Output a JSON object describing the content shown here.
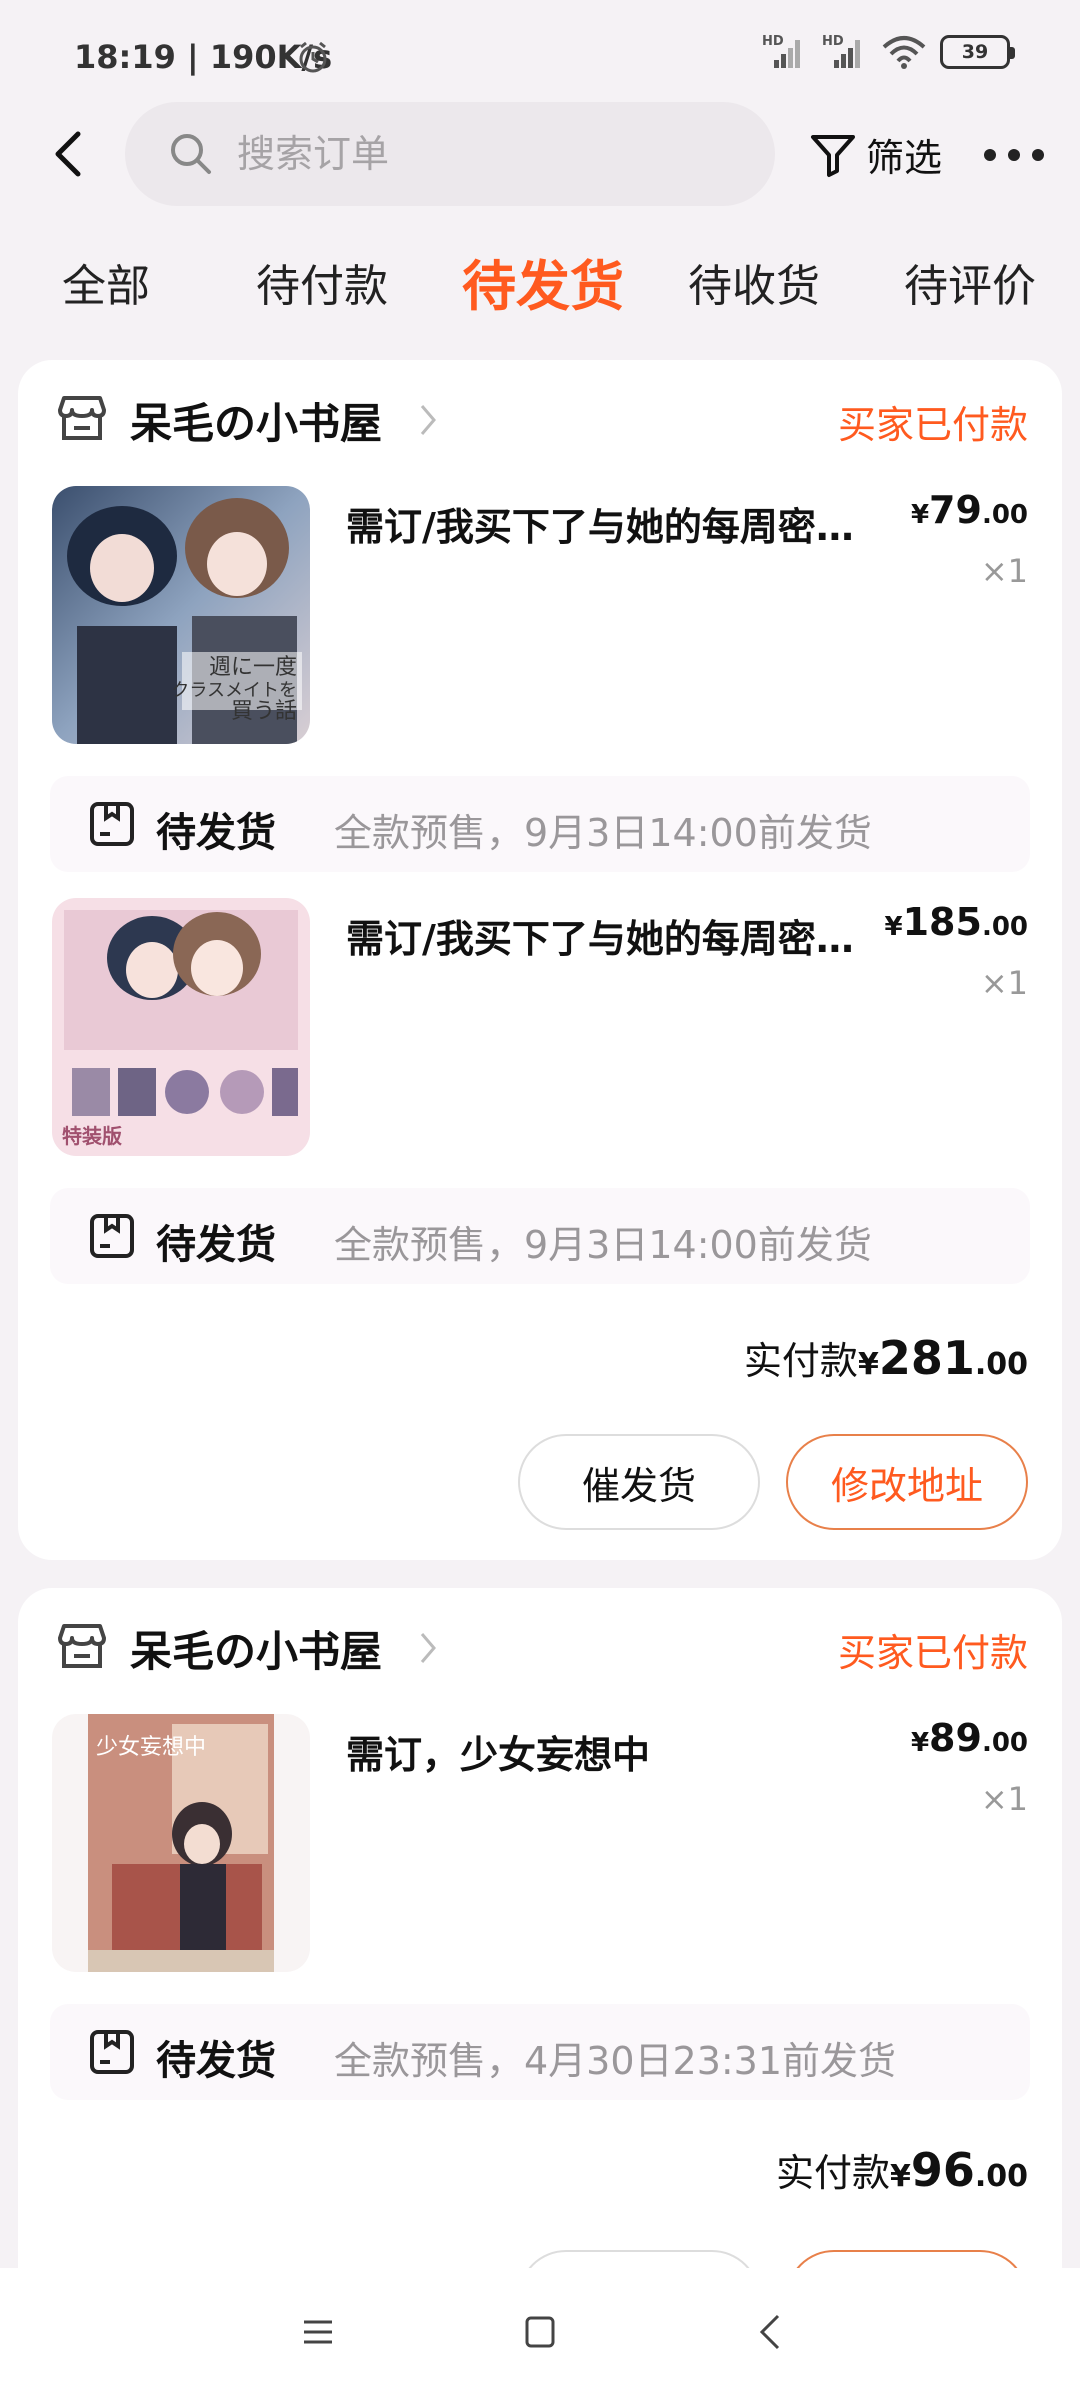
{
  "status_bar": {
    "time": "18:19 | 190K/s",
    "battery": "39",
    "signal_1_label": "HD",
    "signal_2_label": "HD"
  },
  "header": {
    "search_placeholder": "搜索订单",
    "filter_label": "筛选"
  },
  "tabs": [
    {
      "label": "全部",
      "active": false
    },
    {
      "label": "待付款",
      "active": false
    },
    {
      "label": "待发货",
      "active": true
    },
    {
      "label": "待收货",
      "active": false
    },
    {
      "label": "待评价",
      "active": false
    }
  ],
  "orders": [
    {
      "shop_name": "呆毛の小书屋",
      "status": "买家已付款",
      "items": [
        {
          "title": "需订/我买下了与她的每周密…",
          "price_yen": "¥",
          "price_int": "79",
          "price_dec": ".00",
          "qty": "×1",
          "ship_status": "待发货",
          "ship_note": "全款预售，9月3日14:00前发货",
          "cover_text_1": "週に一度",
          "cover_text_2": "クラスメイトを",
          "cover_text_3": "買う話"
        },
        {
          "title": "需订/我买下了与她的每周密…",
          "price_yen": "¥",
          "price_int": "185",
          "price_dec": ".00",
          "qty": "×1",
          "ship_status": "待发货",
          "ship_note": "全款预售，9月3日14:00前发货",
          "cover_text_1": "特装版"
        }
      ],
      "paid_label": "实付款",
      "paid_yen": "¥",
      "paid_int": "281",
      "paid_dec": ".00",
      "btn_urge": "催发货",
      "btn_address": "修改地址"
    },
    {
      "shop_name": "呆毛の小书屋",
      "status": "买家已付款",
      "items": [
        {
          "title": "需订，少女妄想中",
          "price_yen": "¥",
          "price_int": "89",
          "price_dec": ".00",
          "qty": "×1",
          "ship_status": "待发货",
          "ship_note": "全款预售，4月30日23:31前发货",
          "cover_text_1": "少女妄想中"
        }
      ],
      "paid_label": "实付款",
      "paid_yen": "¥",
      "paid_int": "96",
      "paid_dec": ".00"
    }
  ],
  "colors": {
    "accent": "#ff5a1f",
    "background": "#f5f2f5",
    "card": "#ffffff"
  }
}
